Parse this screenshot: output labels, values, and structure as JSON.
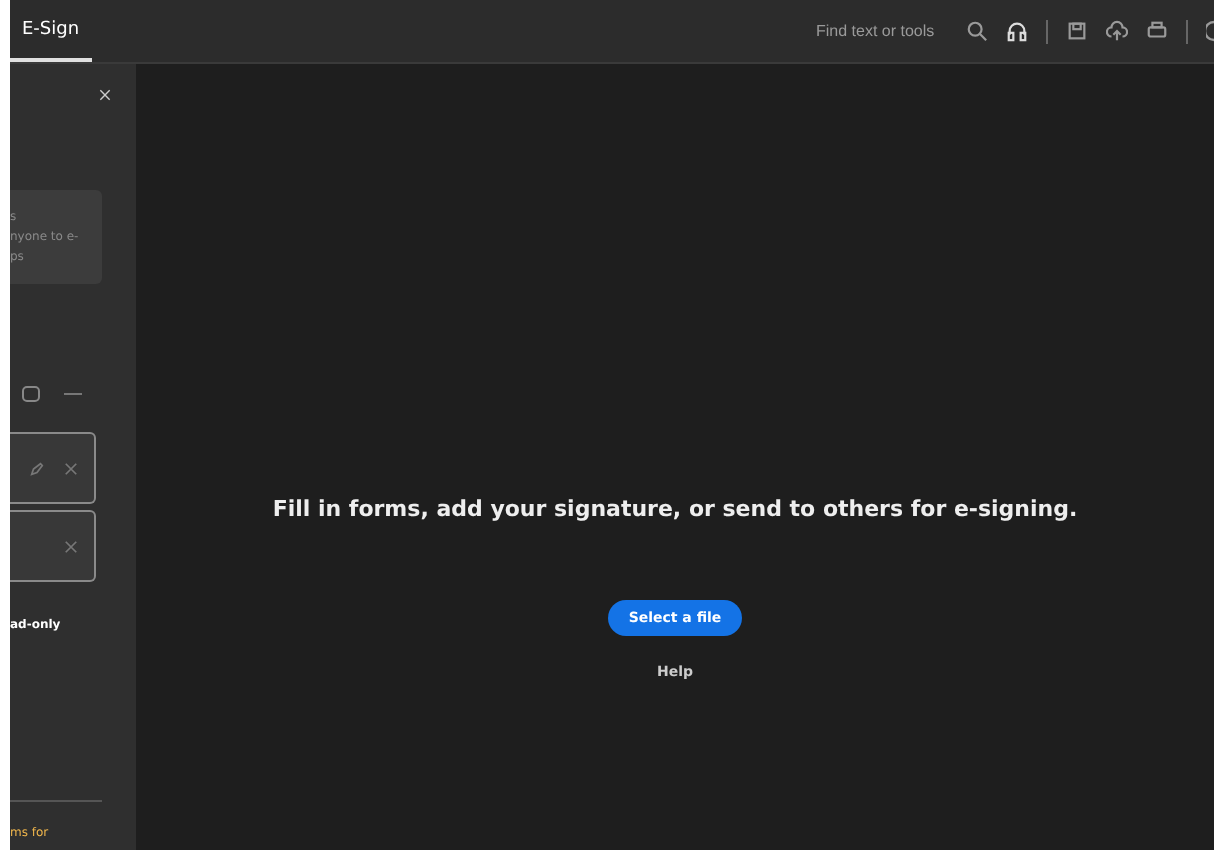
{
  "topbar": {
    "tabs": [
      {
        "label": "E-Sign",
        "selected": true
      }
    ],
    "search": {
      "placeholder": "Find text or tools"
    }
  },
  "sidebar": {
    "card": {
      "lines": [
        "s",
        "nyone to e-",
        "ps"
      ]
    },
    "fields": [
      {
        "kind": "pen"
      },
      {
        "kind": "plain"
      }
    ],
    "note": "ad-only",
    "footer": "ms for"
  },
  "main": {
    "heading": "Fill in forms, add your signature, or send to others for e-signing.",
    "button": "Select a file",
    "help": "Help"
  }
}
